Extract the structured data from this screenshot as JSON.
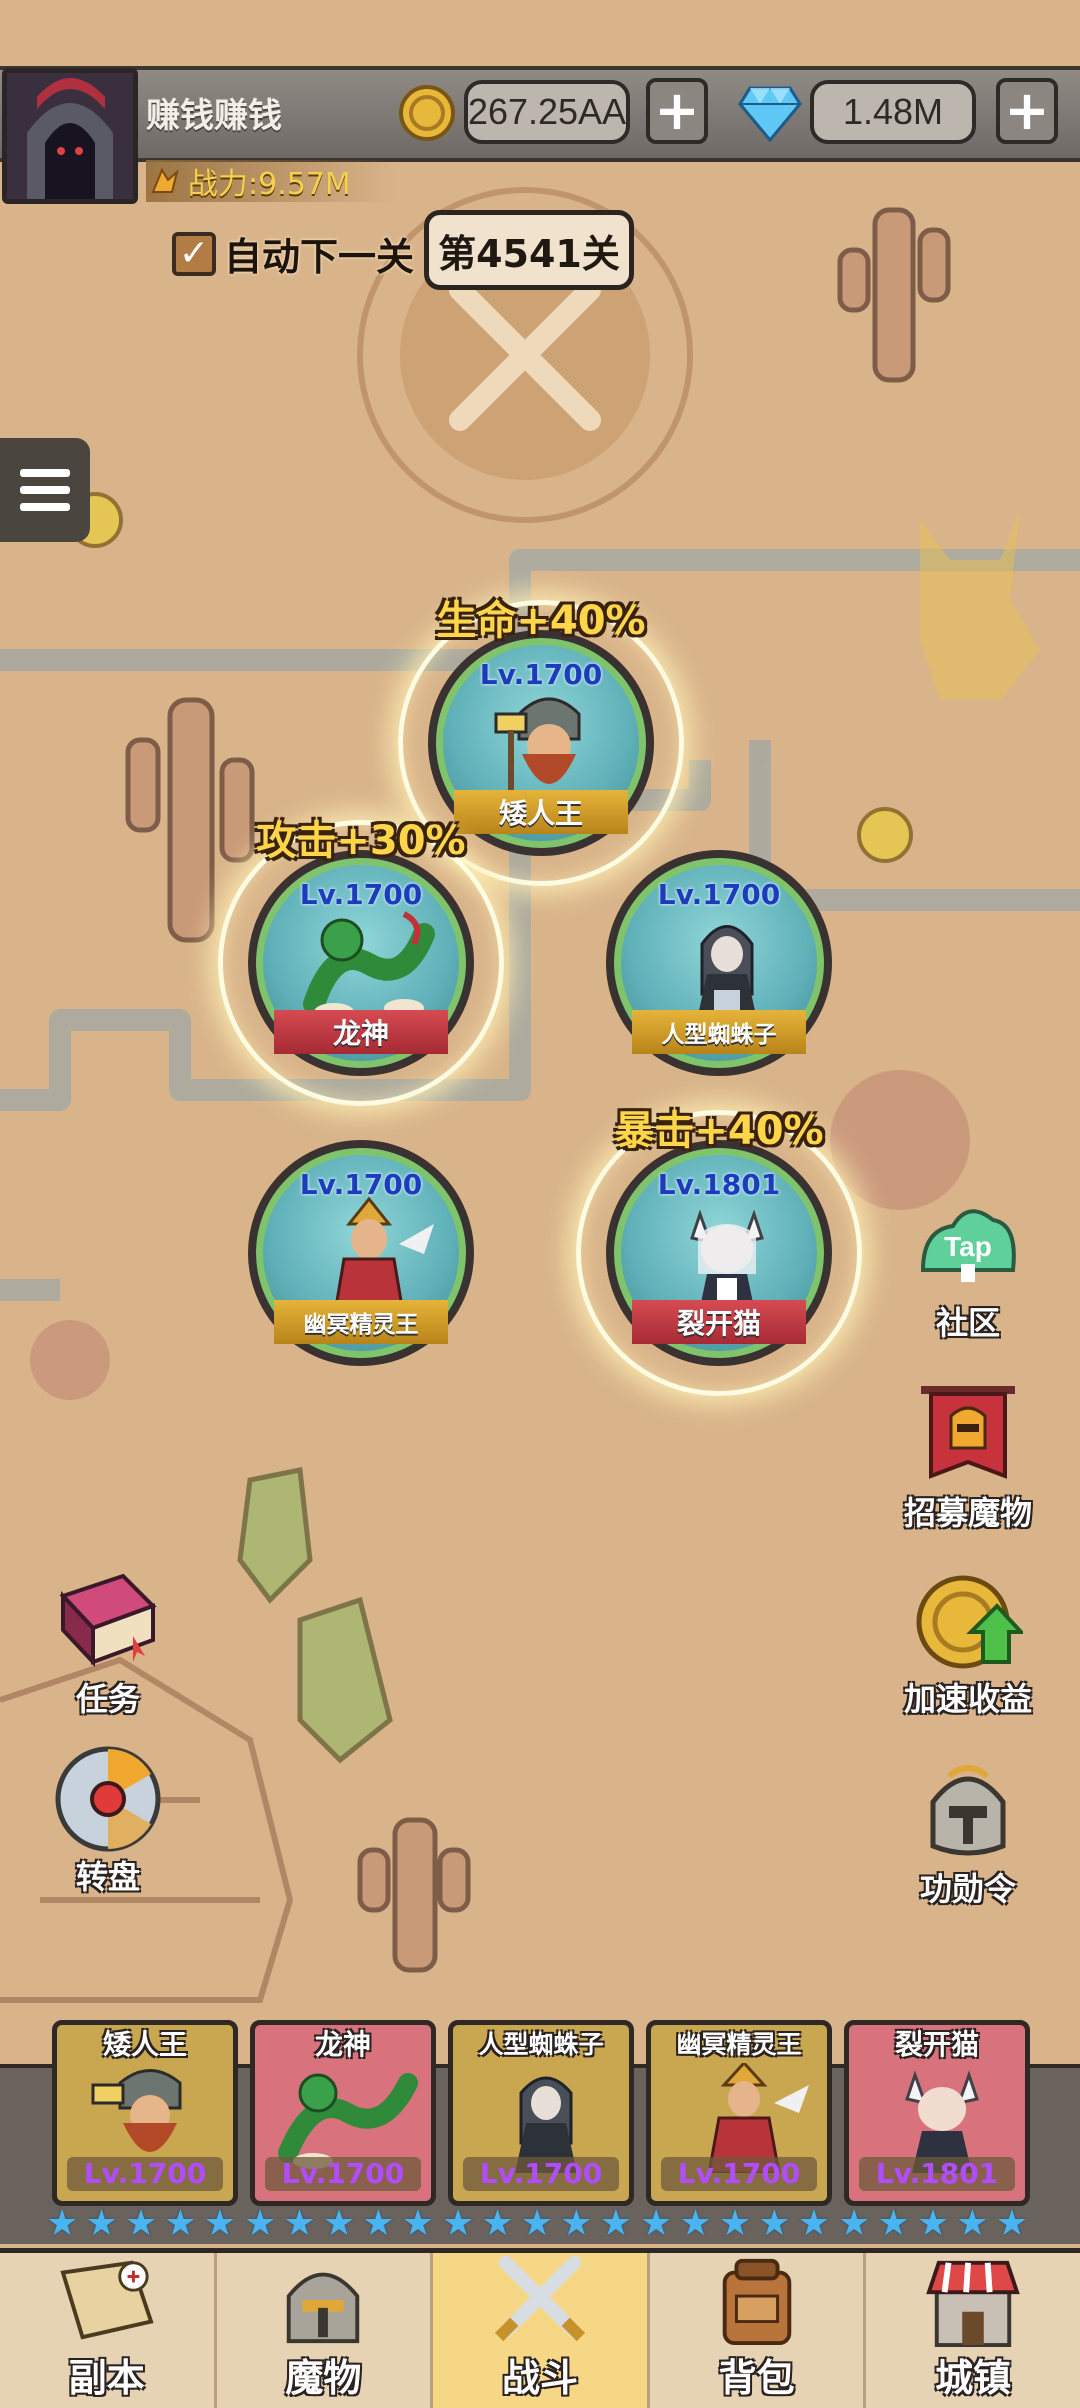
{
  "player": {
    "name": "赚钱赚钱",
    "power": "战力:9.57M"
  },
  "currency": {
    "gold": "267.25AA",
    "gems": "1.48M",
    "plus": "+"
  },
  "stage": {
    "auto_next_label": "自动下一关",
    "auto_next_checked": true,
    "current": "第4541关"
  },
  "formation": [
    {
      "name": "矮人王",
      "level": "Lv.1700",
      "buff": "生命+40%",
      "plate": "gold"
    },
    {
      "name": "龙神",
      "level": "Lv.1700",
      "buff": "攻击+30%",
      "plate": "red"
    },
    {
      "name": "人型蜘蛛子",
      "level": "Lv.1700",
      "buff": "",
      "plate": "gold"
    },
    {
      "name": "幽冥精灵王",
      "level": "Lv.1700",
      "buff": "",
      "plate": "gold"
    },
    {
      "name": "裂开猫",
      "level": "Lv.1801",
      "buff": "暴击+40%",
      "plate": "red"
    }
  ],
  "side_buttons": {
    "community": {
      "label": "社区",
      "badge": "Tap"
    },
    "recruit": "招募魔物",
    "speedup": "加速收益",
    "merit": "功勋令",
    "tasks": "任务",
    "wheel": "转盘"
  },
  "roster": [
    {
      "name": "矮人王",
      "level": "Lv.1700"
    },
    {
      "name": "龙神",
      "level": "Lv.1700"
    },
    {
      "name": "人型蜘蛛子",
      "level": "Lv.1700"
    },
    {
      "name": "幽冥精灵王",
      "level": "Lv.1700"
    },
    {
      "name": "裂开猫",
      "level": "Lv.1801"
    }
  ],
  "nav": {
    "tabs": [
      "副本",
      "魔物",
      "战斗",
      "背包",
      "城镇"
    ],
    "active": "战斗"
  },
  "colors": {
    "map_sand": "#d9b48a",
    "path": "#9fa9a0",
    "gold_text": "#ffd64a",
    "level_blue": "#1b3dbb",
    "roster_level": "#b24cff",
    "star": "#4ab4f0"
  }
}
